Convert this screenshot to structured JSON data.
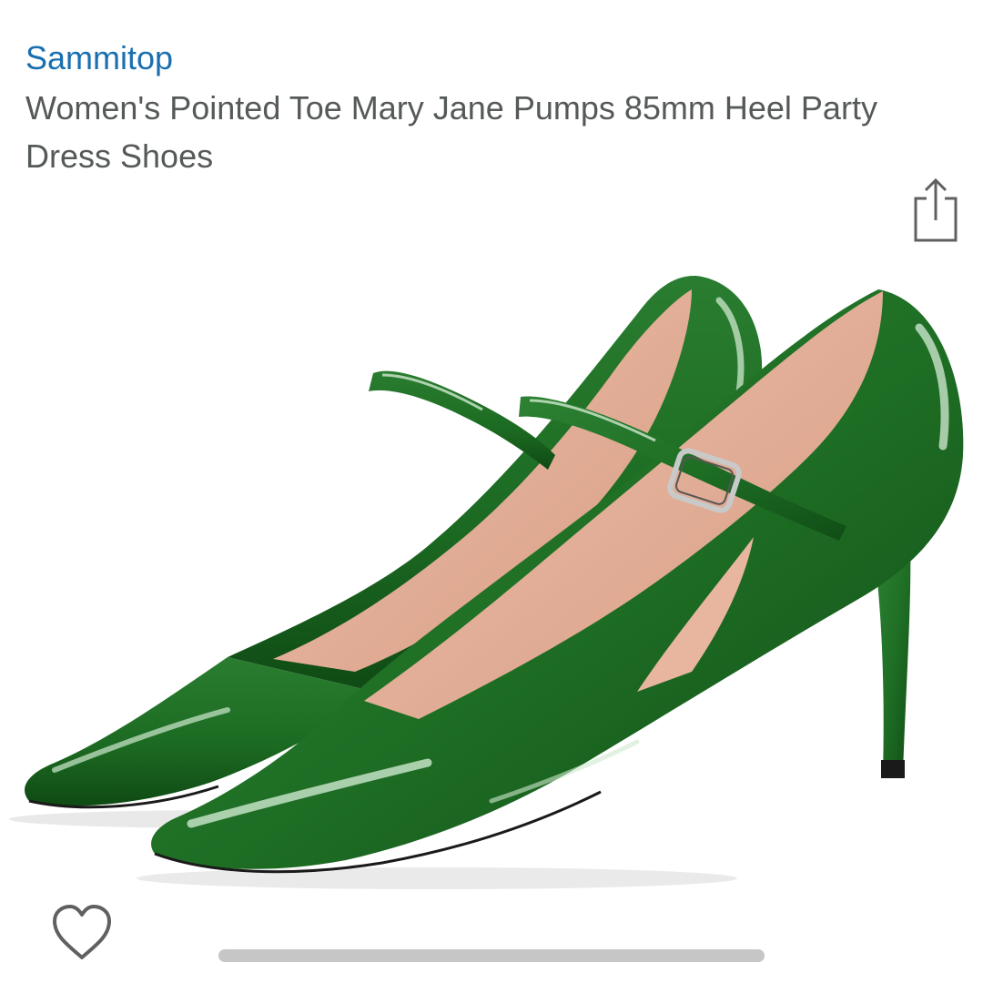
{
  "product": {
    "brand": "Sammitop",
    "title": "Women's Pointed Toe Mary Jane Pumps 85mm Heel Party Dress Shoes",
    "image_alt": "Green patent leather pointed toe Mary Jane pumps with ankle strap and stiletto heel",
    "color_name": "Green"
  },
  "icons": {
    "share": "share-icon",
    "favorite": "heart-outline-icon"
  },
  "colors": {
    "brand_link": "#1a6fb0",
    "title_text": "#565959",
    "shoe_green": "#1d6a22",
    "lining": "#e3ad96",
    "icon_gray": "#5f6060",
    "scrollbar": "#c6c6c6"
  }
}
